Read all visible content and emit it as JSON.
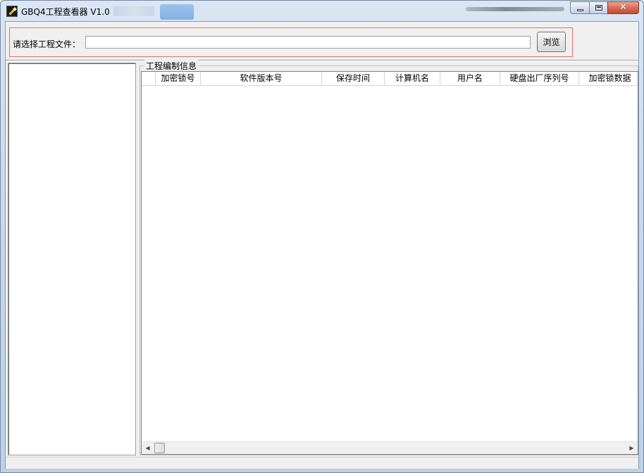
{
  "window": {
    "title": "GBQ4工程查看器 V1.0",
    "close_glyph": "✕",
    "app_icon": "pen-icon"
  },
  "file_select": {
    "label": "请选择工程文件：",
    "input_value": "",
    "browse_label": "浏览"
  },
  "group": {
    "title": "工程编制信息"
  },
  "table": {
    "columns": [
      "",
      "加密锁号",
      "软件版本号",
      "保存时间",
      "计算机名",
      "用户名",
      "硬盘出厂序列号",
      "加密锁数据"
    ]
  },
  "scrollbar": {
    "left_arrow": "◀",
    "right_arrow": "▶"
  },
  "colors": {
    "group_border": "#e0706a",
    "close_button": "#c44a2e"
  }
}
